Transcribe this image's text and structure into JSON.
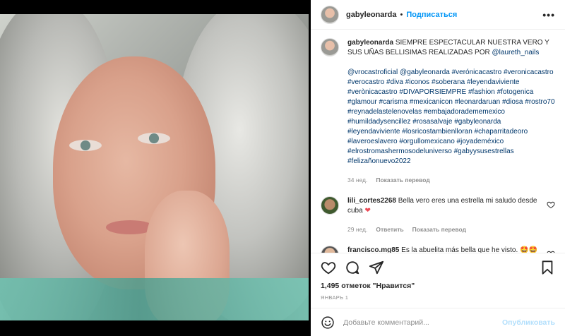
{
  "header": {
    "username": "gabyleonarda",
    "separator": "•",
    "follow_label": "Подписаться",
    "more_label": "•••"
  },
  "caption": {
    "username": "gabyleonarda",
    "text": "SIEMPRE ESPECTACULAR NUESTRA VERO Y SUS UÑAS BELLISIMAS REALIZADAS POR",
    "mention": "@laureth_nails",
    "tags": "@vrocastroficial @gabyleonarda #verónicacastro #veronicacastro #verocastro #diva #iconos #soberana #leyendaviviente #verònicacastro #DIVAPORSIEMPRE #fashion #fotogenica #glamour #carisma #mexicanicon #leonardaruan #diosa #rostro70 #reynadelastelenovelas #embajadoradememexico #humildadysencillez #rosasalvaje #gabyleonarda #leyendaviviente #losricostambienlloran #chaparritadeoro #laveroeslavero #orgullomexicano #joyademéxico #elrostromashermosodeluniverso #gabyysusestrellas #felizañonuevo2022",
    "time": "34 нед.",
    "translate": "Показать перевод"
  },
  "comments": [
    {
      "username": "lili_cortes2268",
      "text": "Bella vero eres una estrella mi saludo desde cuba",
      "emoji": "❤",
      "time": "29 нед.",
      "reply": "Ответить",
      "translate": "Показать перевод"
    },
    {
      "username": "francisco.mg85",
      "text": "Es la abuelita más bella que he visto.",
      "emoji": "🤩🤩🤩🤩"
    }
  ],
  "actions": {
    "likes": "1,495 отметок \"Нравится\"",
    "date": "ЯНВАРЬ 1"
  },
  "add_comment": {
    "placeholder": "Добавьте комментарий...",
    "post_label": "Опубликовать"
  },
  "colors": {
    "link": "#00376b",
    "follow": "#0095f6",
    "heart": "#ed4956"
  }
}
